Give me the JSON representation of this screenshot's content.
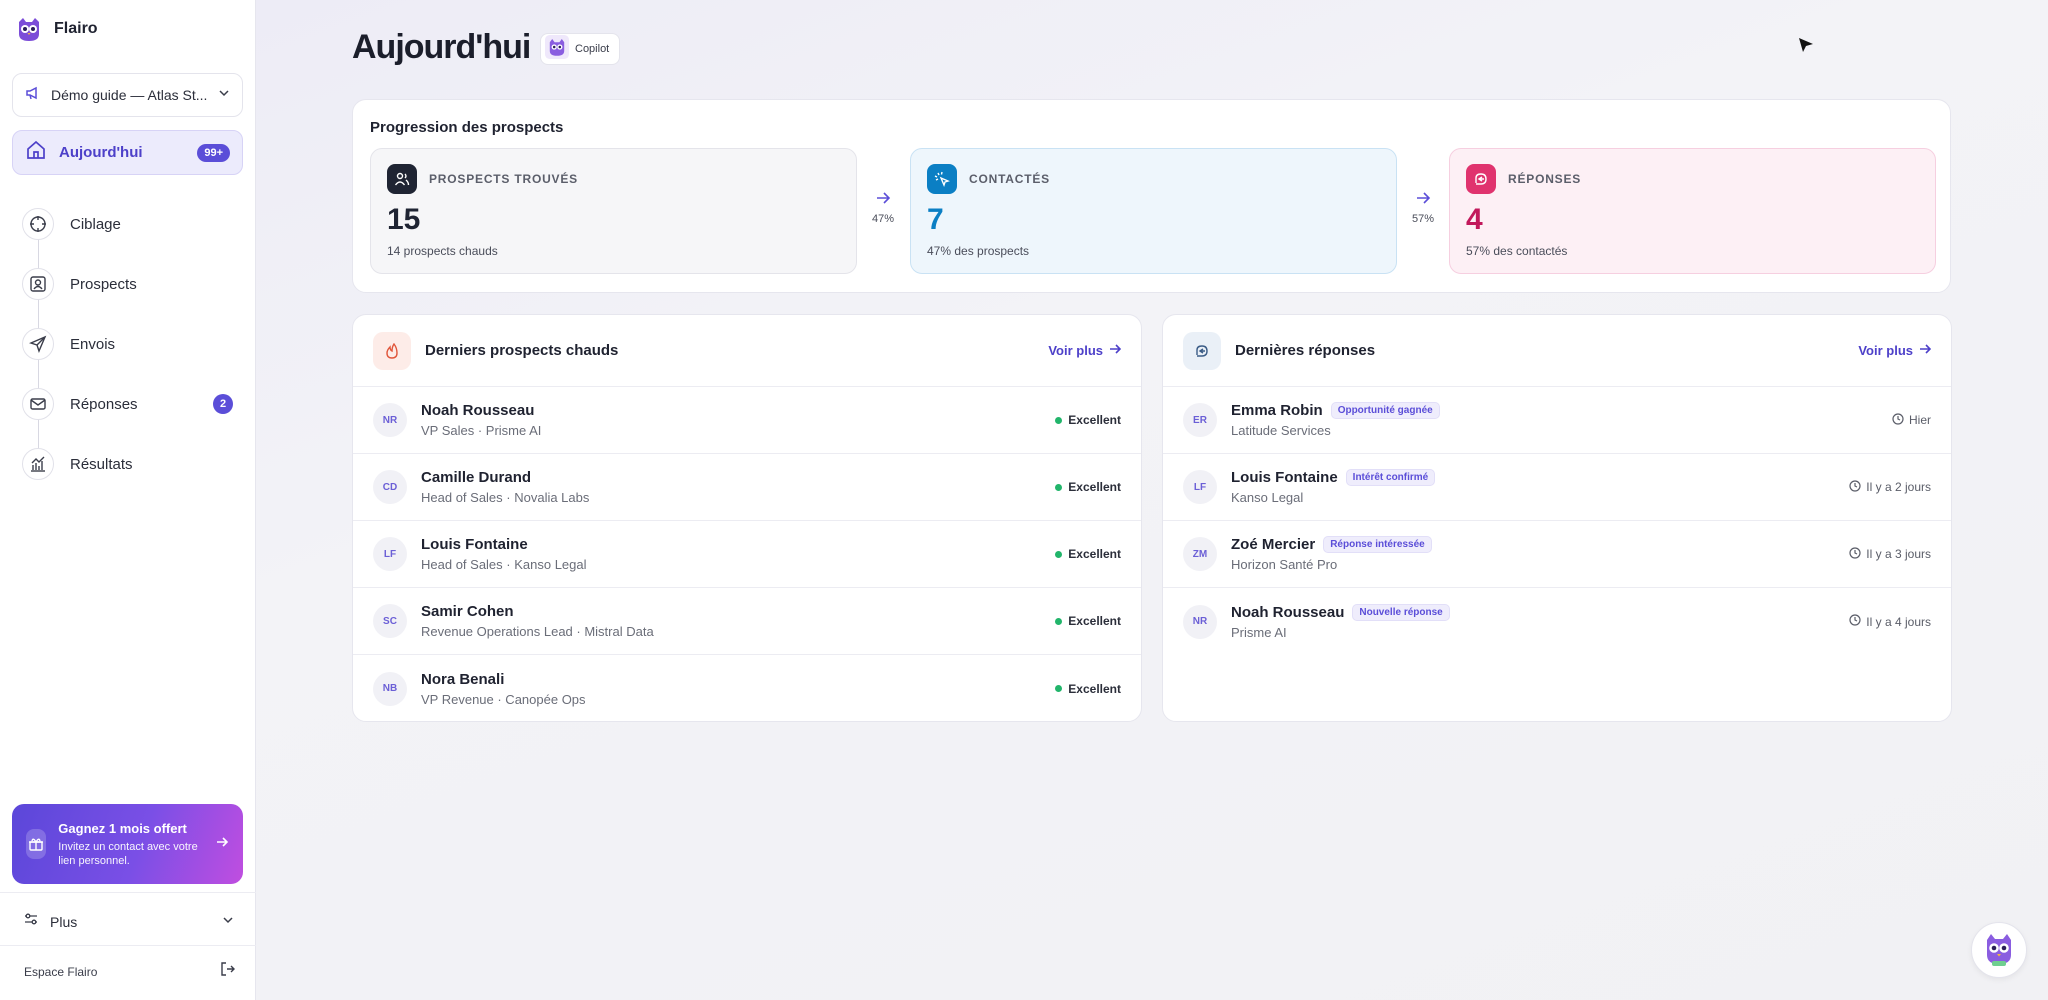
{
  "brand": {
    "name": "Flairo",
    "logo_icon": "owl-logo-icon"
  },
  "campaign_select": {
    "label": "Démo guide — Atlas St..."
  },
  "nav": {
    "today": {
      "label": "Aujourd'hui",
      "badge": "99+"
    },
    "items": [
      {
        "label": "Ciblage",
        "icon": "target-icon"
      },
      {
        "label": "Prospects",
        "icon": "contact-card-icon"
      },
      {
        "label": "Envois",
        "icon": "send-icon"
      },
      {
        "label": "Réponses",
        "icon": "mail-icon",
        "badge": "2"
      },
      {
        "label": "Résultats",
        "icon": "chart-icon"
      }
    ]
  },
  "promo": {
    "title": "Gagnez 1 mois offert",
    "subtitle": "Invitez un contact avec votre lien personnel."
  },
  "footer": {
    "more_label": "Plus",
    "workspace_label": "Espace Flairo"
  },
  "header": {
    "title": "Aujourd'hui",
    "copilot_label": "Copilot"
  },
  "funnel": {
    "title": "Progression des prospects",
    "stages": [
      {
        "label": "PROSPECTS TROUVÉS",
        "value": "15",
        "sub": "14 prospects chauds",
        "color": "#1f2433"
      },
      {
        "label": "CONTACTÉS",
        "value": "7",
        "sub": "47% des prospects",
        "color": "#0b7fc4"
      },
      {
        "label": "RÉPONSES",
        "value": "4",
        "sub": "57% des contactés",
        "color": "#c2185b"
      }
    ],
    "conversions": [
      "47%",
      "57%"
    ]
  },
  "hot_prospects": {
    "title": "Derniers prospects chauds",
    "more_label": "Voir plus",
    "rows": [
      {
        "initials": "NR",
        "name": "Noah Rousseau",
        "sub": "VP Sales · Prisme AI",
        "score": "Excellent"
      },
      {
        "initials": "CD",
        "name": "Camille Durand",
        "sub": "Head of Sales · Novalia Labs",
        "score": "Excellent"
      },
      {
        "initials": "LF",
        "name": "Louis Fontaine",
        "sub": "Head of Sales · Kanso Legal",
        "score": "Excellent"
      },
      {
        "initials": "SC",
        "name": "Samir Cohen",
        "sub": "Revenue Operations Lead · Mistral Data",
        "score": "Excellent"
      },
      {
        "initials": "NB",
        "name": "Nora Benali",
        "sub": "VP Revenue · Canopée Ops",
        "score": "Excellent"
      }
    ]
  },
  "replies": {
    "title": "Dernières réponses",
    "more_label": "Voir plus",
    "rows": [
      {
        "initials": "ER",
        "name": "Emma Robin",
        "tag": "Opportunité gagnée",
        "sub": "Latitude Services",
        "time": "Hier"
      },
      {
        "initials": "LF",
        "name": "Louis Fontaine",
        "tag": "Intérêt confirmé",
        "sub": "Kanso Legal",
        "time": "Il y a 2 jours"
      },
      {
        "initials": "ZM",
        "name": "Zoé Mercier",
        "tag": "Réponse intéressée",
        "sub": "Horizon Santé Pro",
        "time": "Il y a 3 jours"
      },
      {
        "initials": "NR",
        "name": "Noah Rousseau",
        "tag": "Nouvelle réponse",
        "sub": "Prisme AI",
        "time": "Il y a 4 jours"
      }
    ]
  },
  "colors": {
    "accent": "#5b4ed8",
    "success": "#22b56b"
  }
}
